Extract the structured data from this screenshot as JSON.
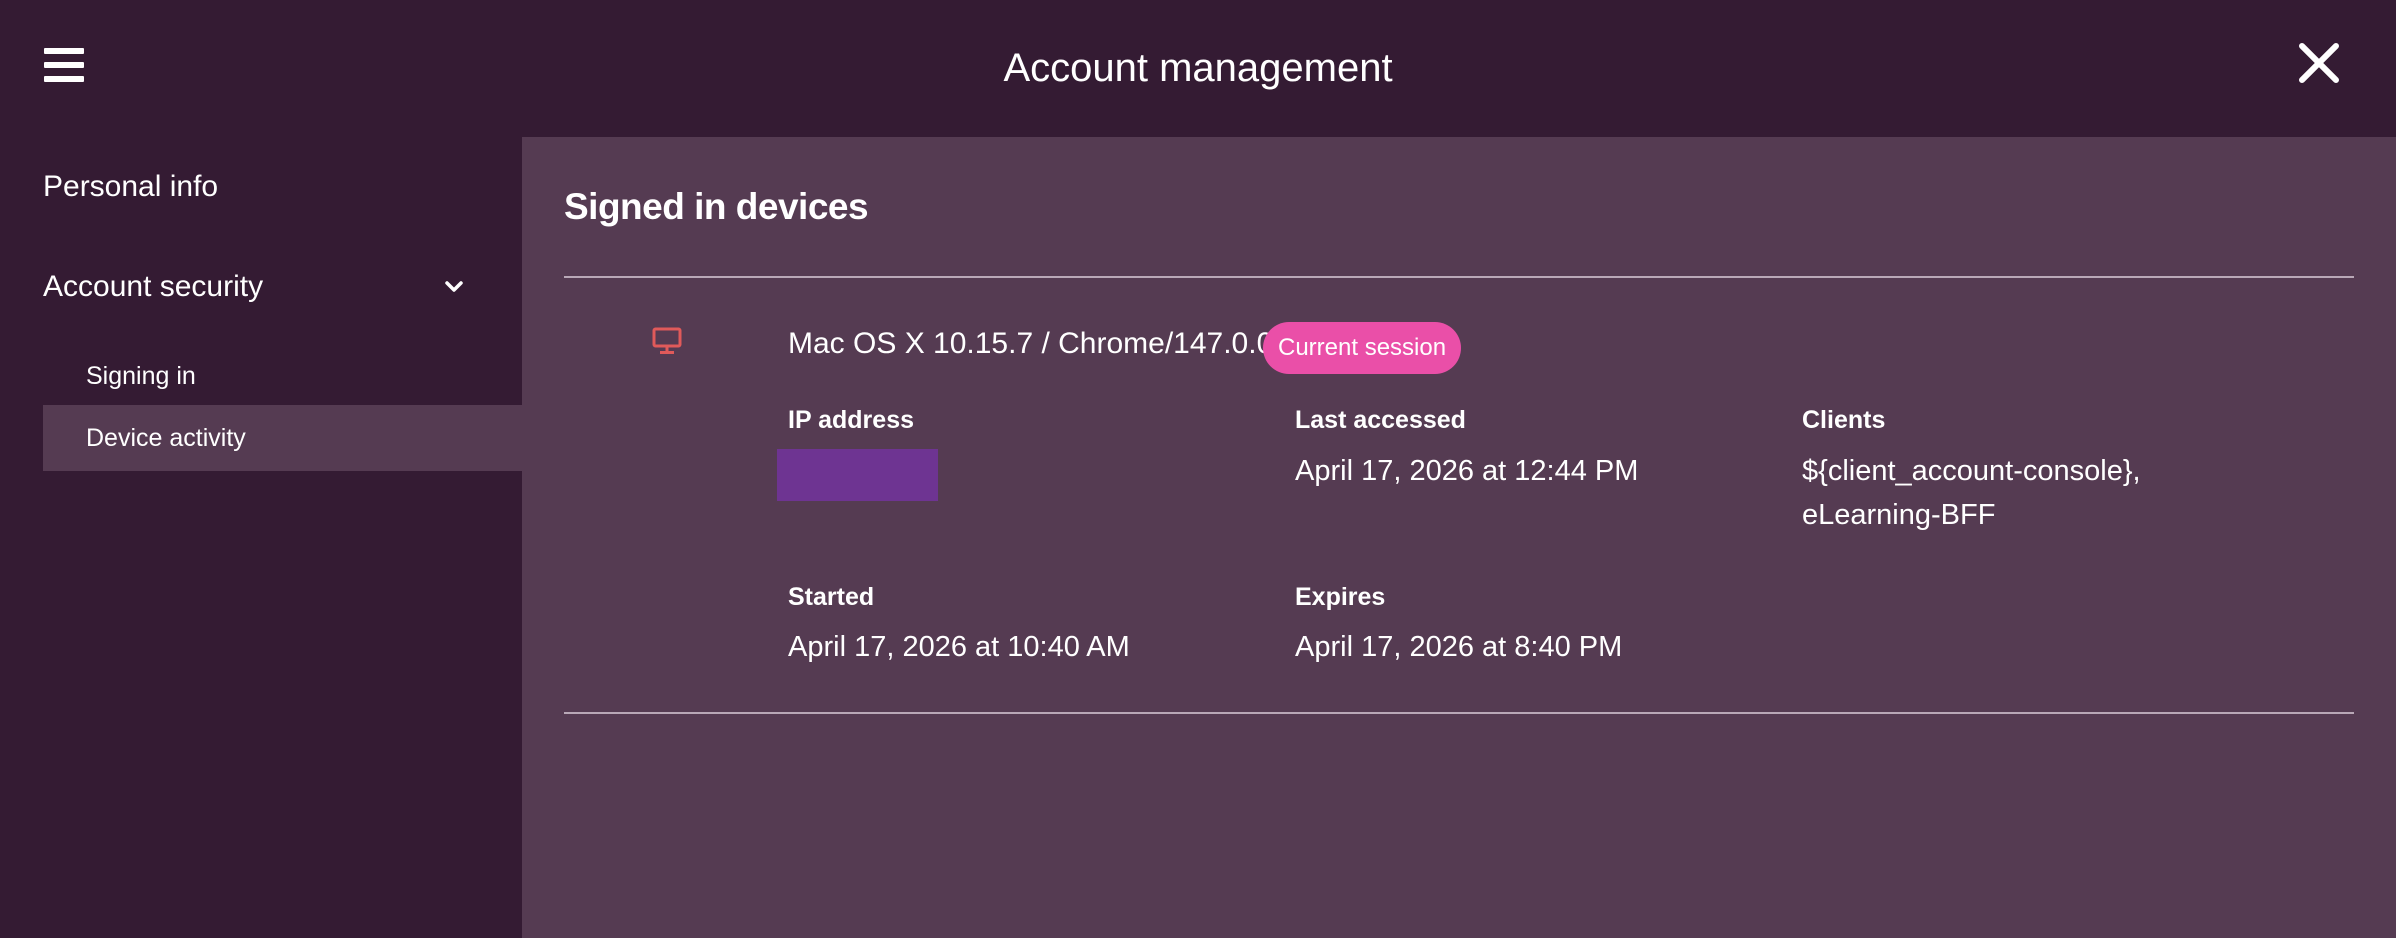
{
  "header": {
    "title": "Account management",
    "menu_icon": "hamburger-menu-icon",
    "close_icon": "close-icon"
  },
  "sidebar": {
    "items": [
      {
        "label": "Personal info"
      },
      {
        "label": "Account security",
        "expanded": true,
        "icon": "chevron-down-icon"
      }
    ],
    "subitems": [
      {
        "label": "Signing in"
      },
      {
        "label": "Device activity",
        "selected": true
      }
    ]
  },
  "main": {
    "title": "Signed in devices",
    "device": {
      "icon": "desktop-icon",
      "icon_color": "#e05a5a",
      "name": "Mac OS X 10.15.7 / Chrome/147.0.0",
      "badge": "Current session",
      "badge_color": "#ea4fa8",
      "fields": {
        "ip_label": "IP address",
        "last_accessed_label": "Last accessed",
        "last_accessed_value": "April 17, 2026 at 12:44 PM",
        "clients_label": "Clients",
        "clients_value_line1": "${client_account-console},",
        "clients_value_line2": "eLearning-BFF",
        "started_label": "Started",
        "started_value": "April 17, 2026 at 10:40 AM",
        "expires_label": "Expires",
        "expires_value": "April 17, 2026 at 8:40 PM"
      }
    }
  }
}
